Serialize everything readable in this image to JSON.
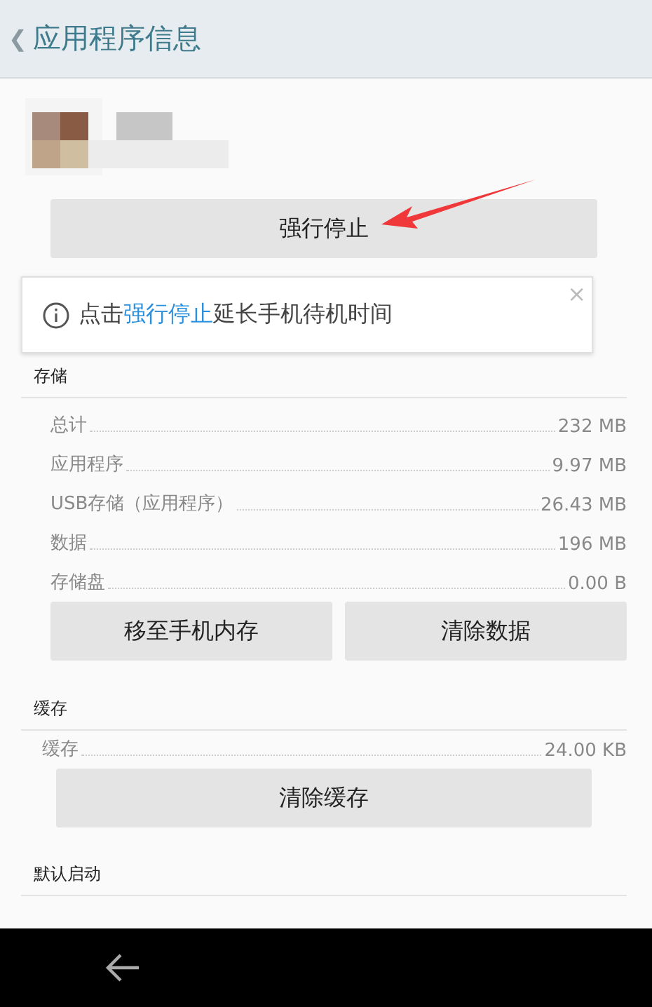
{
  "header": {
    "back": "❮",
    "title": "应用程序信息"
  },
  "force_stop": {
    "label": "强行停止"
  },
  "tip": {
    "text": "点击**强行停止**延长手机待机时间",
    "close": "×"
  },
  "storage": {
    "title": "存储",
    "rows": [
      {
        "label": "总计",
        "value": "232 MB"
      },
      {
        "label": "应用程序",
        "value": "9.97 MB"
      },
      {
        "label": "USB存储（应用程序）",
        "value": "26.43 MB"
      },
      {
        "label": "数据",
        "value": "196 MB"
      },
      {
        "label": "存储盘",
        "value": "0.00 B"
      }
    ],
    "buttons": [
      "移至手机内存",
      "清除数据"
    ]
  },
  "cache": {
    "title": "缓存",
    "rows": [
      {
        "label": "缓存",
        "value": "24.00 KB"
      }
    ],
    "button": "清除缓存"
  },
  "default_launch": {
    "title": "默认启动"
  }
}
